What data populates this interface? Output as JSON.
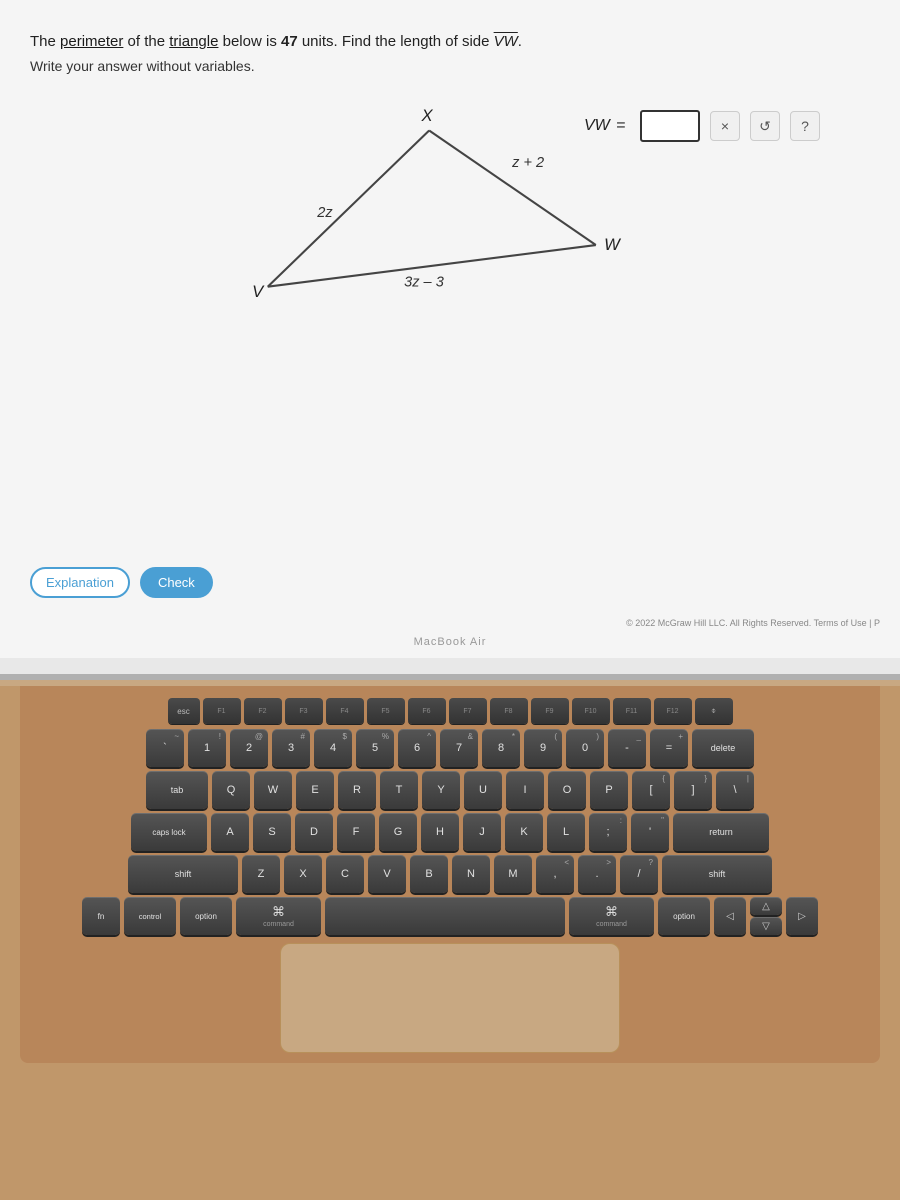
{
  "browser": {
    "accent_color": "#4a9fd4"
  },
  "problem": {
    "text_before": "The ",
    "perimeter": "perimeter",
    "text_mid1": " of the ",
    "triangle_word": "triangle",
    "text_mid2": " below is ",
    "value": "47",
    "text_mid3": " units. Find the length of side ",
    "side": "VW",
    "write_line": "Write your answer without variables.",
    "vw_label": "VW =",
    "sides": {
      "top": "X",
      "top_right": "z + 2",
      "left": "2z",
      "bottom": "3z – 3",
      "vertex_v": "V",
      "vertex_w": "W"
    }
  },
  "buttons": {
    "explanation": "Explanation",
    "check": "Check"
  },
  "actions": {
    "close": "×",
    "refresh": "↺",
    "help": "?"
  },
  "copyright": "© 2022 McGraw Hill LLC. All Rights Reserved.   Terms of Use | P",
  "macbook": "MacBook Air",
  "keyboard": {
    "fn_keys": [
      "esc",
      "F1",
      "F2",
      "F3",
      "F4",
      "F5",
      "F6",
      "F7",
      "F8",
      "F9",
      "F10",
      "F11",
      "F12",
      "⌽"
    ],
    "row1": [
      {
        "top": "~",
        "main": "`"
      },
      {
        "top": "!",
        "main": "1"
      },
      {
        "top": "@",
        "main": "2"
      },
      {
        "top": "#",
        "main": "3"
      },
      {
        "top": "$",
        "main": "4"
      },
      {
        "top": "%",
        "main": "5"
      },
      {
        "top": "^",
        "main": "6"
      },
      {
        "top": "&",
        "main": "7"
      },
      {
        "top": "*",
        "main": "8"
      },
      {
        "top": "(",
        "main": "9"
      },
      {
        "top": ")",
        "main": "0"
      },
      {
        "top": "_",
        "main": "-"
      },
      {
        "top": "+",
        "main": "="
      },
      {
        "main": "delete",
        "wide": true
      }
    ],
    "row2": [
      {
        "main": "tab",
        "wide": true
      },
      {
        "main": "Q"
      },
      {
        "main": "W"
      },
      {
        "main": "E"
      },
      {
        "main": "R"
      },
      {
        "main": "T"
      },
      {
        "main": "Y"
      },
      {
        "main": "U"
      },
      {
        "main": "I"
      },
      {
        "main": "O"
      },
      {
        "main": "P"
      },
      {
        "top": "{",
        "main": "["
      },
      {
        "top": "}",
        "main": "]"
      },
      {
        "top": "|",
        "main": "\\"
      }
    ],
    "row3": [
      {
        "main": "caps lock",
        "wider": true
      },
      {
        "main": "A"
      },
      {
        "main": "S"
      },
      {
        "main": "D"
      },
      {
        "main": "F"
      },
      {
        "main": "G"
      },
      {
        "main": "H"
      },
      {
        "main": "J"
      },
      {
        "main": "K"
      },
      {
        "main": "L"
      },
      {
        "top": ":",
        "main": ";"
      },
      {
        "top": "\"",
        "main": "'"
      },
      {
        "main": "return",
        "widest": true
      }
    ],
    "row4": [
      {
        "main": "shift",
        "widest": true
      },
      {
        "main": "Z"
      },
      {
        "main": "X"
      },
      {
        "main": "C"
      },
      {
        "main": "V"
      },
      {
        "main": "B"
      },
      {
        "main": "N"
      },
      {
        "main": "M"
      },
      {
        "top": "<",
        "main": ","
      },
      {
        "top": ">",
        "main": "."
      },
      {
        "top": "?",
        "main": "/"
      },
      {
        "main": "shift",
        "widest": true
      }
    ],
    "row5": [
      {
        "main": "fn"
      },
      {
        "main": "control"
      },
      {
        "main": "option"
      },
      {
        "main": "⌘\ncommand",
        "cmd": true
      },
      {
        "main": "",
        "space": true
      },
      {
        "main": "⌘\ncommand",
        "cmd": true
      },
      {
        "main": "option"
      },
      {
        "main": "◁"
      },
      {
        "main": "▽"
      },
      {
        "main": "▷"
      }
    ]
  }
}
